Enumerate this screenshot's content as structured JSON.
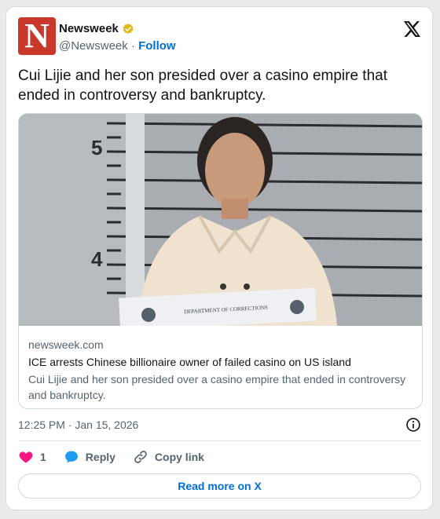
{
  "author": {
    "name": "Newsweek",
    "handle": "@Newsweek",
    "separator": "·",
    "follow_label": "Follow",
    "avatar_letter": "N",
    "avatar_color": "#c8392b",
    "verified_color": "#e2b719"
  },
  "tweet": {
    "text": "Cui Lijie and her son presided over a casino empire that ended in controversy and bankruptcy.",
    "timestamp": "12:25 PM · Jan 15, 2026"
  },
  "link_card": {
    "domain": "newsweek.com",
    "title": "ICE arrests Chinese billionaire owner of failed casino on US island",
    "description": "Cui Lijie and her son presided over a casino empire that ended in controversy and bankruptcy.",
    "image": {
      "height_mark_5": "5",
      "height_mark_4": "4",
      "placard_text": "DEPARTMENT OF CORRECTIONS"
    }
  },
  "actions": {
    "like_count": "1",
    "reply_label": "Reply",
    "copy_link_label": "Copy link",
    "read_more_label": "Read more on X"
  },
  "colors": {
    "link_blue": "#006fd6",
    "like_pink": "#f91880",
    "reply_blue": "#1d9bf0",
    "muted_text": "#536471"
  }
}
